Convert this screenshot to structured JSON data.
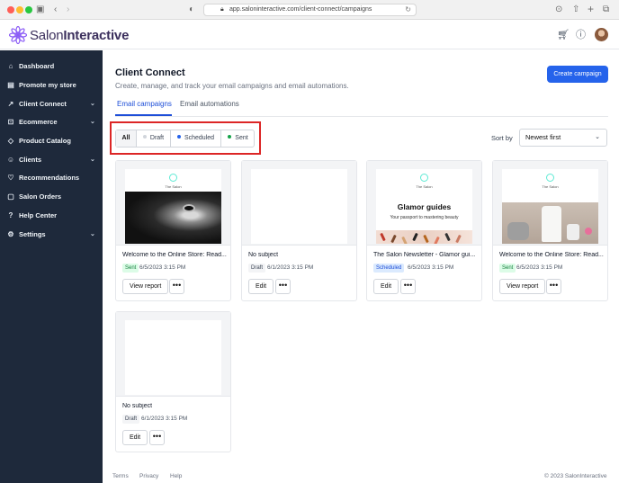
{
  "browser": {
    "url": "app.saloninteractive.com/client-connect/campaigns"
  },
  "brand": {
    "name_light": "Salon",
    "name_bold": "Interactive",
    "accent_color": "#2563eb",
    "sidebar_color": "#1e293b"
  },
  "header_icons": [
    "cart-icon",
    "help-icon",
    "avatar"
  ],
  "sidebar": {
    "items": [
      {
        "label": "Dashboard",
        "icon": "home-icon",
        "glyph": "⌂",
        "expandable": false
      },
      {
        "label": "Promote my store",
        "icon": "store-icon",
        "glyph": "▤",
        "expandable": false
      },
      {
        "label": "Client Connect",
        "icon": "chart-icon",
        "glyph": "↗",
        "expandable": true
      },
      {
        "label": "Ecommerce",
        "icon": "cart-icon",
        "glyph": "⊡",
        "expandable": true
      },
      {
        "label": "Product Catalog",
        "icon": "tag-icon",
        "glyph": "◇",
        "expandable": false
      },
      {
        "label": "Clients",
        "icon": "users-icon",
        "glyph": "☺",
        "expandable": true
      },
      {
        "label": "Recommendations",
        "icon": "heart-icon",
        "glyph": "♡",
        "expandable": false
      },
      {
        "label": "Salon Orders",
        "icon": "orders-icon",
        "glyph": "▢",
        "expandable": false
      },
      {
        "label": "Help Center",
        "icon": "help-icon",
        "glyph": "?",
        "expandable": false
      },
      {
        "label": "Settings",
        "icon": "gear-icon",
        "glyph": "⚙",
        "expandable": true
      }
    ]
  },
  "page": {
    "title": "Client Connect",
    "subtitle": "Create, manage, and track your email campaigns and email automations.",
    "create_button": "Create campaign"
  },
  "tabs": [
    {
      "label": "Email campaigns",
      "active": true
    },
    {
      "label": "Email automations",
      "active": false
    }
  ],
  "filters": [
    {
      "label": "All",
      "active": true,
      "dot": ""
    },
    {
      "label": "Draft",
      "active": false,
      "dot": "#d1d5db"
    },
    {
      "label": "Scheduled",
      "active": false,
      "dot": "#2563eb"
    },
    {
      "label": "Sent",
      "active": false,
      "dot": "#16a34a"
    }
  ],
  "sort": {
    "label": "Sort by",
    "value": "Newest first"
  },
  "campaigns": [
    {
      "title": "Welcome to the Online Store: Read...",
      "status": "Sent",
      "date": "6/5/2023 3:15 PM",
      "action": "View report",
      "thumb": "portrait",
      "thumb_name": "The Salon"
    },
    {
      "title": "No subject",
      "status": "Draft",
      "date": "6/1/2023 3:15 PM",
      "action": "Edit",
      "thumb": "blank",
      "thumb_name": ""
    },
    {
      "title": "The Salon Newsletter - Glamor gui...",
      "status": "Scheduled",
      "date": "6/5/2023 3:15 PM",
      "action": "Edit",
      "thumb": "newsletter",
      "thumb_name": "The Salon",
      "thumb_heading": "Glamor guides",
      "thumb_tagline": "Your passport to mastering beauty"
    },
    {
      "title": "Welcome to the Online Store: Read...",
      "status": "Sent",
      "date": "6/5/2023 3:15 PM",
      "action": "View report",
      "thumb": "products",
      "thumb_name": "The Salon"
    },
    {
      "title": "No subject",
      "status": "Draft",
      "date": "6/1/2023 3:15 PM",
      "action": "Edit",
      "thumb": "blank",
      "thumb_name": ""
    }
  ],
  "more_glyph": "•••",
  "footer": {
    "links": [
      "Terms",
      "Privacy",
      "Help"
    ],
    "copyright": "© 2023 SalonInteractive"
  }
}
